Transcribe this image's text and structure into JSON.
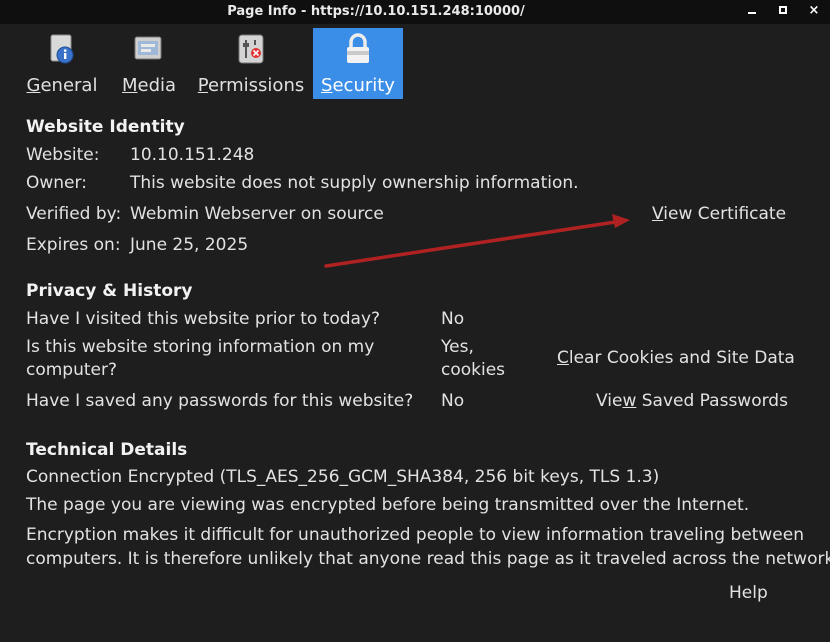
{
  "window": {
    "title": "Page Info - https://10.10.151.248:10000/",
    "close_glyph": "×"
  },
  "tabs": [
    {
      "id": "general",
      "label": "General",
      "accesskey": "G",
      "icon": "info-icon"
    },
    {
      "id": "media",
      "label": "Media",
      "accesskey": "M",
      "icon": "media-icon"
    },
    {
      "id": "permissions",
      "label": "Permissions",
      "accesskey": "P",
      "icon": "permissions-icon"
    },
    {
      "id": "security",
      "label": "Security",
      "accesskey": "S",
      "icon": "lock-icon",
      "selected": true
    }
  ],
  "identity": {
    "heading": "Website Identity",
    "website_label": "Website:",
    "website_value": "10.10.151.248",
    "owner_label": "Owner:",
    "owner_value": "This website does not supply ownership information.",
    "verified_label": "Verified by:",
    "verified_value": "Webmin Webserver on source",
    "expires_label": "Expires on:",
    "expires_value": "June 25, 2025",
    "view_cert_first": "V",
    "view_cert_rest": "iew Certificate"
  },
  "privacy": {
    "heading": "Privacy & History",
    "q1": "Have I visited this website prior to today?",
    "a1": "No",
    "q2_line1": "Is this website storing information on my",
    "q2_line2": "computer?",
    "a2_line1": "Yes,",
    "a2_line2": "cookies",
    "clear_first": "C",
    "clear_rest": "lear Cookies and Site Data",
    "q3": "Have I saved any passwords for this website?",
    "a3": "No",
    "saved_pre": "Vie",
    "saved_u": "w",
    "saved_rest": " Saved Passwords"
  },
  "technical": {
    "heading": "Technical Details",
    "line1": "Connection Encrypted (TLS_AES_256_GCM_SHA384, 256 bit keys, TLS 1.3)",
    "line2": "The page you are viewing was encrypted before being transmitted over the Internet.",
    "line3": "Encryption makes it difficult for unauthorized people to view information traveling between",
    "line4": "computers. It is therefore unlikely that anyone read this page as it traveled across the network."
  },
  "help_label": "Help",
  "annotation": {
    "color": "#b02222"
  },
  "colors": {
    "background": "#1e1e1e",
    "selected_tab": "#3b8ee8",
    "text": "#e2e2e2"
  }
}
